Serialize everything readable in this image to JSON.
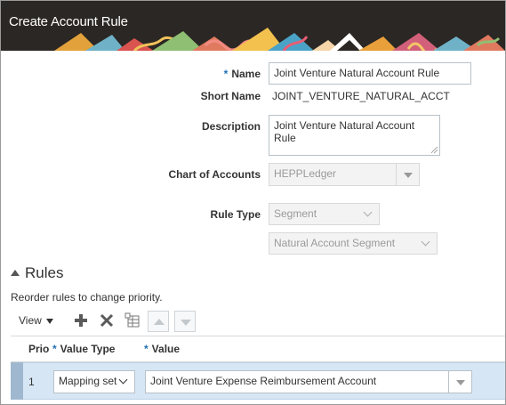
{
  "header": {
    "title": "Create Account Rule"
  },
  "form": {
    "name": {
      "label": "Name",
      "required_mark": "*",
      "value": "Joint Venture Natural Account Rule"
    },
    "short_name": {
      "label": "Short Name",
      "value": "JOINT_VENTURE_NATURAL_ACCT"
    },
    "description": {
      "label": "Description",
      "value": "Joint Venture Natural Account Rule"
    },
    "chart_of_accounts": {
      "label": "Chart of Accounts",
      "value": "HEPPLedger"
    },
    "rule_type": {
      "label": "Rule Type",
      "value": "Segment",
      "segment_value": "Natural Account Segment"
    }
  },
  "rules": {
    "title": "Rules",
    "hint": "Reorder rules to change priority.",
    "toolbar": {
      "view_label": "View"
    },
    "columns": {
      "priority": "Prio",
      "value_type": "Value Type",
      "value": "Value",
      "required_mark": "*"
    },
    "rows": [
      {
        "priority": "1",
        "value_type": "Mapping set",
        "value": "Joint Venture Expense Reimbursement Account"
      }
    ]
  },
  "icons": [
    "add-icon",
    "delete-icon",
    "freeze-columns-icon",
    "move-up-icon",
    "move-down-icon",
    "dropdown-arrow-icon",
    "collapse-triangle-icon"
  ],
  "colors": {
    "header_bg": "#2b2724",
    "required_asterisk": "#1f6fb2",
    "selected_row": "#d6e6f5"
  }
}
